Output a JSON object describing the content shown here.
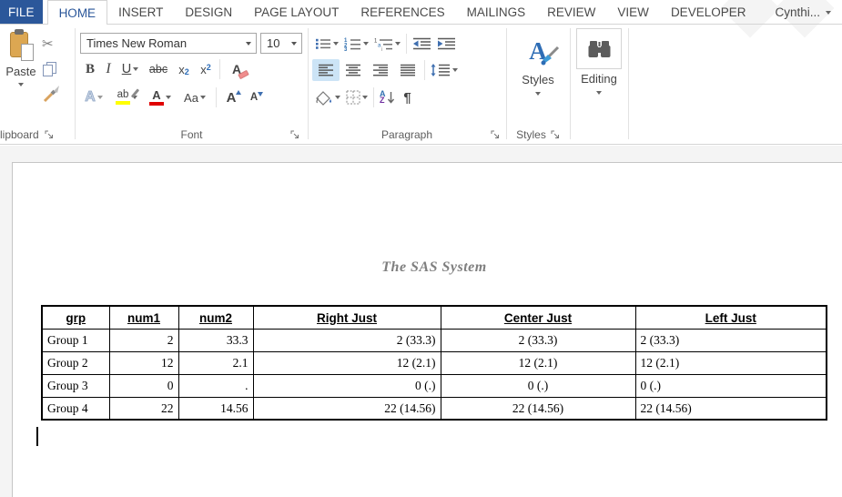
{
  "tabbar": {
    "file": "FILE",
    "tabs": [
      "HOME",
      "INSERT",
      "DESIGN",
      "PAGE LAYOUT",
      "REFERENCES",
      "MAILINGS",
      "REVIEW",
      "VIEW",
      "DEVELOPER"
    ],
    "user": "Cynthi..."
  },
  "ribbon": {
    "clipboard": {
      "label": "lipboard",
      "paste": "Paste"
    },
    "font": {
      "label": "Font",
      "name": "Times New Roman",
      "size": "10",
      "bold": "B",
      "italic": "I",
      "underline": "U",
      "strike": "abc",
      "sub_x": "x",
      "sub_2": "2",
      "sup_x": "x",
      "sup_2": "2",
      "clear": "A",
      "effects": "A",
      "highlight": "ab",
      "color": "A",
      "case": "Aa",
      "grow": "A",
      "shrink": "A"
    },
    "paragraph": {
      "label": "Paragraph",
      "n1": "1",
      "n2": "2",
      "n3": "3",
      "m1": "1",
      "m2": "a",
      "m3": "i",
      "sort_a": "A",
      "sort_z": "Z",
      "pilcrow": "¶"
    },
    "styles": {
      "label": "Styles",
      "button": "Styles",
      "letter": "A"
    },
    "editing": {
      "button": "Editing"
    }
  },
  "icons": {
    "cut": "✂"
  },
  "document": {
    "title": "The SAS System",
    "table": {
      "headers": [
        "grp",
        "num1",
        "num2",
        "Right Just",
        "Center Just",
        "Left Just"
      ],
      "rows": [
        [
          "Group 1",
          "2",
          "33.3",
          "2 (33.3)",
          "2 (33.3)",
          "2 (33.3)"
        ],
        [
          "Group 2",
          "12",
          "2.1",
          "12 (2.1)",
          "12 (2.1)",
          "12 (2.1)"
        ],
        [
          "Group 3",
          "0",
          ".",
          "0 (.)",
          "0 (.)",
          "0 (.)"
        ],
        [
          "Group 4",
          "22",
          "14.56",
          "22 (14.56)",
          "22 (14.56)",
          "22 (14.56)"
        ]
      ]
    }
  },
  "colors": {
    "accent": "#2b579a",
    "selection_blue": "#cce4f6",
    "highlight_yellow": "#ffff00",
    "font_color_red": "#e00000"
  }
}
